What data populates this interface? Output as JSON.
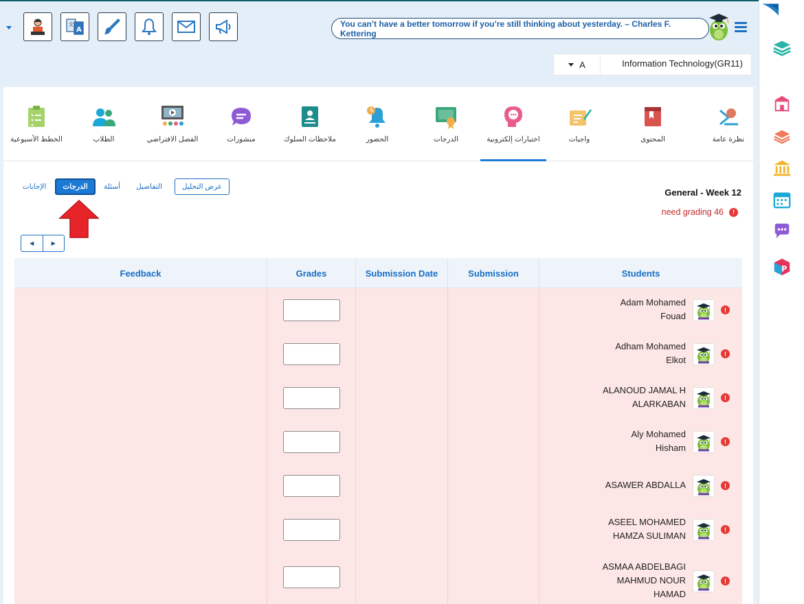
{
  "header": {
    "quote": "You can’t have a better tomorrow if you’re still thinking about yesterday. – Charles F. Kettering",
    "toolbar_icons": [
      "teacher-icon",
      "translate-icon",
      "brush-icon",
      "bell-icon",
      "mail-icon",
      "megaphone-icon"
    ],
    "section_select": "A",
    "subject": "Information Technology(GR11)"
  },
  "sidebar": {
    "icons": [
      "school-icon",
      "layers-icon",
      "institution-icon",
      "calendar-icon",
      "chat-icon",
      "p-app-icon"
    ]
  },
  "tabs": [
    {
      "label": "نظرة عامة",
      "icon": "overview-icon"
    },
    {
      "label": "المحتوى",
      "icon": "book-icon"
    },
    {
      "label": "واجبات",
      "icon": "homework-icon"
    },
    {
      "label": "اختبارات إلكترونية",
      "icon": "quiz-icon",
      "active": true
    },
    {
      "label": "الدرجات",
      "icon": "certificate-icon"
    },
    {
      "label": "الحضور",
      "icon": "attendance-icon"
    },
    {
      "label": "ملاحظات السلوك",
      "icon": "behavior-icon"
    },
    {
      "label": "منشورات",
      "icon": "posts-icon"
    },
    {
      "label": "الفصل الافتراضي",
      "icon": "virtual-class-icon"
    },
    {
      "label": "الطلاب",
      "icon": "students-icon"
    },
    {
      "label": "الخطط الأسبوعية",
      "icon": "weekly-plan-icon"
    }
  ],
  "actions": {
    "analysis": "عرض التحليل",
    "details": "التفاصيل",
    "questions": "أسئلة",
    "grades": "الدرجات",
    "answers": "الإجابات"
  },
  "exam": {
    "title": "General - Week 12",
    "need_grading": "need grading 46"
  },
  "table": {
    "headers": {
      "feedback": "Feedback",
      "grades": "Grades",
      "submission_date": "Submission Date",
      "submission": "Submission",
      "students": "Students"
    },
    "rows": [
      {
        "name": "Adam Mohamed Fouad",
        "lines": [
          "Adam Mohamed",
          "Fouad"
        ]
      },
      {
        "name": "Adham Mohamed Elkot",
        "lines": [
          "Adham Mohamed",
          "Elkot"
        ]
      },
      {
        "name": "ALANOUD JAMAL H ALARKABAN",
        "lines": [
          "ALANOUD JAMAL H",
          "ALARKABAN"
        ]
      },
      {
        "name": "Aly Mohamed Hisham",
        "lines": [
          "Aly Mohamed",
          "Hisham"
        ]
      },
      {
        "name": "ASAWER ABDALLA",
        "lines": [
          "ASAWER ABDALLA"
        ]
      },
      {
        "name": "ASEEL MOHAMED HAMZA SULIMAN",
        "lines": [
          "ASEEL MOHAMED",
          "HAMZA SULIMAN"
        ]
      },
      {
        "name": "ASMAA ABDELBAGI MAHMUD NOUR HAMAD",
        "lines": [
          "ASMAA ABDELBAGI",
          "MAHMUD NOUR",
          "HAMAD"
        ]
      }
    ]
  },
  "colors": {
    "accent": "#1a7ad6",
    "row_bg": "#fde6e6",
    "alert": "#e53935"
  }
}
